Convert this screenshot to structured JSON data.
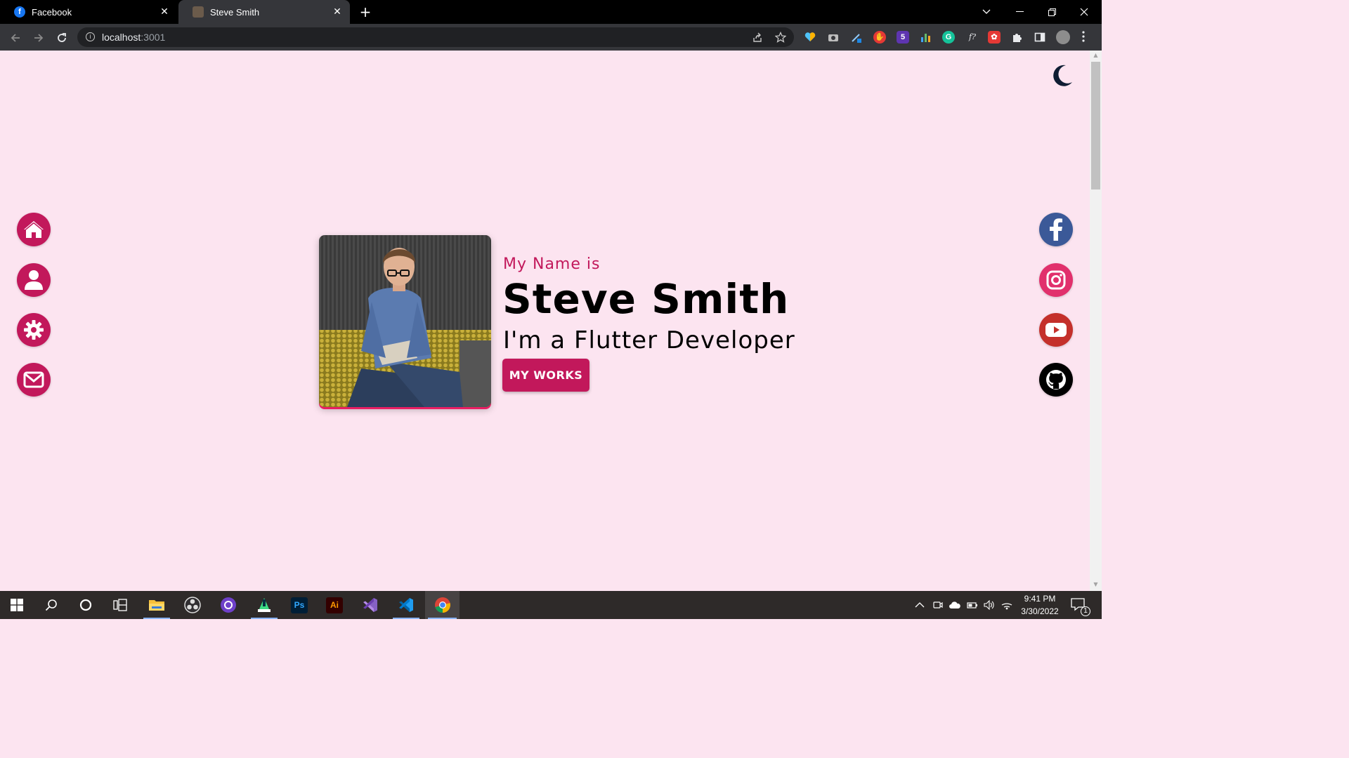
{
  "browser": {
    "tabs": [
      {
        "title": "Facebook",
        "icon": "facebook-favicon",
        "active": false
      },
      {
        "title": "Steve Smith",
        "icon": "page-favicon",
        "active": true
      }
    ],
    "url_host": "localhost",
    "url_port": ":3001",
    "close_glyph": "✕",
    "new_tab_glyph": "+"
  },
  "page": {
    "greeting": "My Name is",
    "name": "Steve Smith",
    "role": "I'm a Flutter Developer",
    "cta_label": "MY WORKS",
    "left_nav": [
      "home-icon",
      "user-icon",
      "settings-icon",
      "mail-icon"
    ],
    "social": [
      {
        "name": "facebook-icon",
        "color": "#3b5998"
      },
      {
        "name": "instagram-icon",
        "color": "#e1306c"
      },
      {
        "name": "youtube-icon",
        "color": "#c4302b"
      },
      {
        "name": "github-icon",
        "color": "#000000"
      }
    ],
    "accent": "#c2185b",
    "background": "#fce4f0"
  },
  "taskbar": {
    "time": "9:41 PM",
    "date": "3/30/2022",
    "notification_count": "1",
    "apps": [
      "start-icon",
      "search-icon",
      "cortana-icon",
      "task-view-icon",
      "file-explorer-icon",
      "obs-icon",
      "github-desktop-icon",
      "android-studio-icon",
      "photoshop-icon",
      "illustrator-icon",
      "visual-studio-icon",
      "vscode-icon",
      "chrome-icon"
    ],
    "ps_label": "Ps",
    "ai_label": "Ai"
  }
}
